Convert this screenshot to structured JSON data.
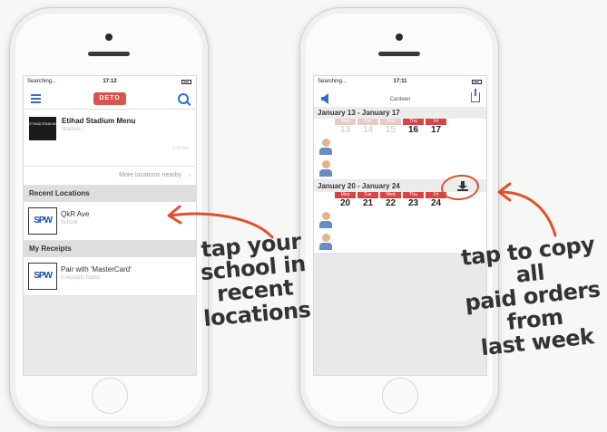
{
  "left_phone": {
    "status": {
      "carrier": "Searching...",
      "time": "17:12"
    },
    "logo_text": "DETO",
    "venue": {
      "badge": "ETIHAD STADIUM",
      "title": "Etihad Stadium Menu",
      "subtitle": "Stadium",
      "distance": "0.00 km"
    },
    "more_locations": "More locations nearby",
    "recent_header": "Recent Locations",
    "recent_item": {
      "badge": "SPW",
      "name": "QkR Ave",
      "sub": "School"
    },
    "receipts_header": "My Receipts",
    "receipt_item": {
      "badge": "SPW",
      "name": "Pair with 'MasterCard'",
      "sub": "0 receipts found"
    }
  },
  "right_phone": {
    "status": {
      "carrier": "Searching...",
      "time": "17:11"
    },
    "title": "Canteen",
    "week1": {
      "label": "January 13 - January 17",
      "days": [
        {
          "name": "Mon",
          "date": "13"
        },
        {
          "name": "Tue",
          "date": "14"
        },
        {
          "name": "Wed",
          "date": "15"
        },
        {
          "name": "Thu",
          "date": "16"
        },
        {
          "name": "Fri",
          "date": "17"
        }
      ]
    },
    "week2": {
      "label": "January 20 - January 24",
      "days": [
        {
          "name": "Mon",
          "date": "20"
        },
        {
          "name": "Tue",
          "date": "21"
        },
        {
          "name": "Wed",
          "date": "22"
        },
        {
          "name": "Thu",
          "date": "23"
        },
        {
          "name": "Fri",
          "date": "24"
        }
      ]
    }
  },
  "annotations": {
    "left_line1": "tap your",
    "left_line2": "school in",
    "left_line3": "recent locations",
    "right_line1": "tap to copy all",
    "right_line2": "paid orders",
    "right_line3": "from",
    "right_line4": "last week"
  },
  "colors": {
    "accent": "#2c6fcc",
    "day_red": "#d64545",
    "annotation": "#e0502e"
  }
}
